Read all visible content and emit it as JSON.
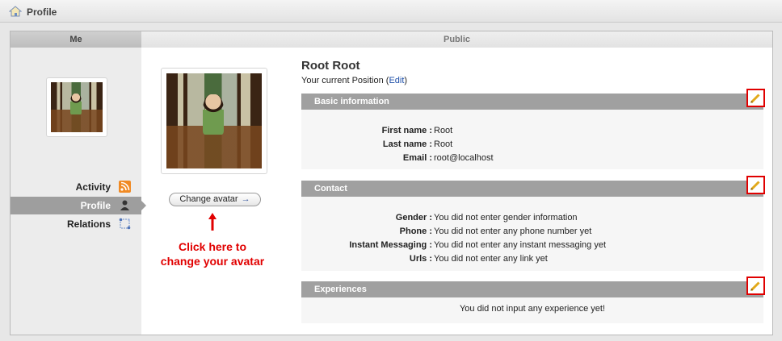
{
  "window": {
    "title": "Profile"
  },
  "tabs": {
    "me": "Me",
    "public": "Public"
  },
  "sidebar": {
    "items": [
      {
        "label": "Activity",
        "icon": "rss-icon"
      },
      {
        "label": "Profile",
        "icon": "person-icon",
        "active": true
      },
      {
        "label": "Relations",
        "icon": "relations-icon"
      }
    ]
  },
  "avatar": {
    "change_label": "Change avatar",
    "change_arrow": "→",
    "annotation_line1": "Click here to",
    "annotation_line2": "change your avatar"
  },
  "profile": {
    "name": "Root Root",
    "position_text": "Your current Position (",
    "position_link": "Edit",
    "position_close": ")"
  },
  "sections": {
    "basic": {
      "title": "Basic information",
      "fields": [
        {
          "key": "First name :",
          "value": "Root"
        },
        {
          "key": "Last name :",
          "value": "Root"
        },
        {
          "key": "Email :",
          "value": "root@localhost"
        }
      ]
    },
    "contact": {
      "title": "Contact",
      "fields": [
        {
          "key": "Gender :",
          "value": "You did not enter gender information"
        },
        {
          "key": "Phone :",
          "value": "You did not enter any phone number yet"
        },
        {
          "key": "Instant Messaging :",
          "value": "You did not enter any instant messaging yet"
        },
        {
          "key": "Urls :",
          "value": "You did not enter any link yet"
        }
      ]
    },
    "experiences": {
      "title": "Experiences",
      "empty": "You did not input any experience yet!"
    }
  },
  "colors": {
    "annotation": "#e10000",
    "link": "#1d4fa8",
    "section_bar": "#a0a0a0",
    "highlight_border": "#e00000"
  }
}
